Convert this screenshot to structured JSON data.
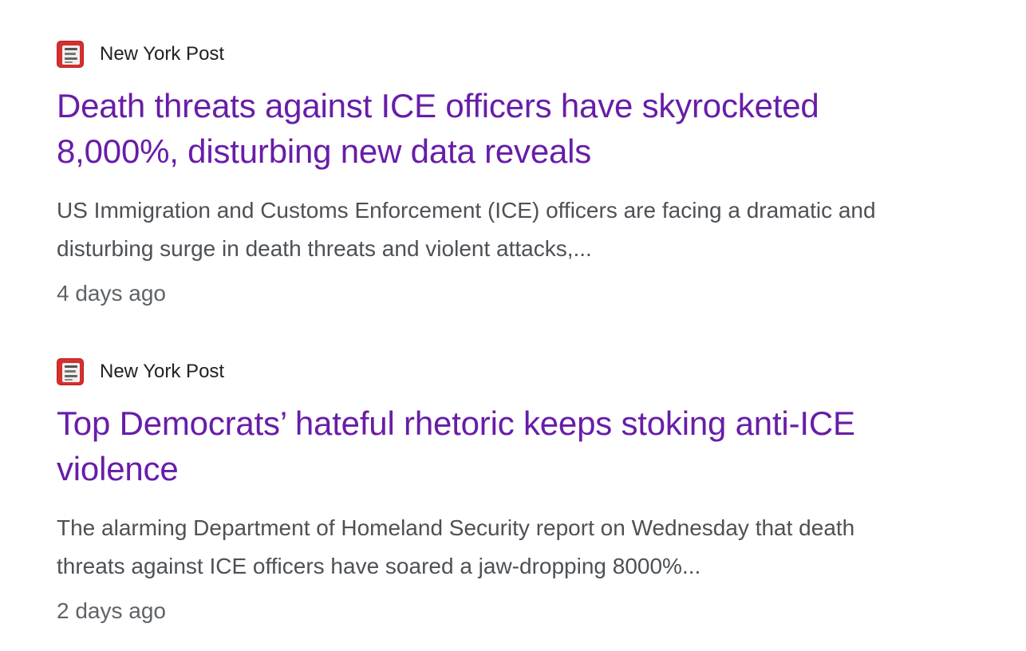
{
  "results": [
    {
      "source": "New York Post",
      "favicon_icon": "new-york-post-logo-icon",
      "headline_line1": "Death threats against ICE officers have skyrocketed",
      "headline_line2": "8,000%, disturbing new data reveals",
      "snippet_line1": "US Immigration and Customs Enforcement (ICE) officers are facing a dramatic and",
      "snippet_line2": "disturbing surge in death threats and violent attacks,...",
      "age": "4 days ago"
    },
    {
      "source": "New York Post",
      "favicon_icon": "new-york-post-logo-icon",
      "headline_line1": "Top Democrats’ hateful rhetoric keeps stoking anti-ICE",
      "headline_line2": "violence",
      "snippet_line1": "The alarming Department of Homeland Security report on Wednesday that death",
      "snippet_line2": "threats against ICE officers have soared a jaw-dropping 8000%...",
      "age": "2 days ago"
    }
  ],
  "colors": {
    "headline": "#681da8",
    "snippet": "#4d5156",
    "age": "#5f6368",
    "source": "#202124",
    "favicon": "#d3302e"
  }
}
